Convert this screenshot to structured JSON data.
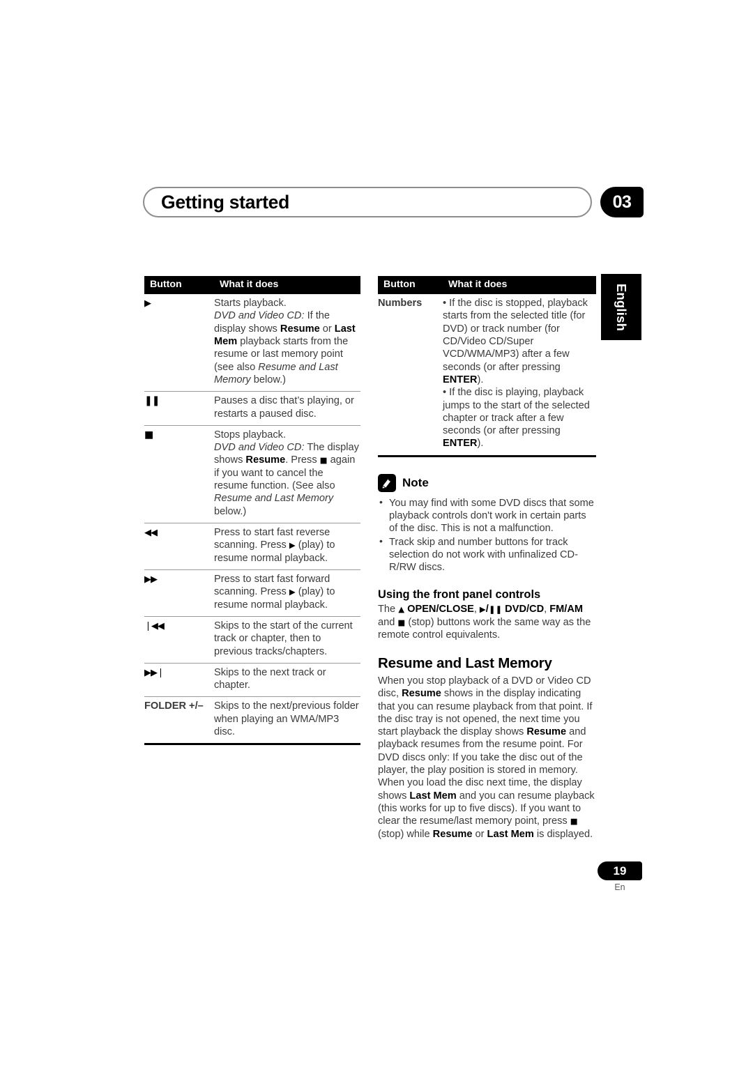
{
  "header": {
    "title": "Getting started",
    "chapter_number": "03"
  },
  "language_tab": "English",
  "left_table": {
    "columns": [
      "Button",
      "What it does"
    ],
    "rows": [
      {
        "button_icon": "play-icon",
        "button_glyph": "▶",
        "lines": [
          "Starts playback.",
          "DVD and Video CD: If the display shows Resume or Last Mem playback starts from the resume or last memory point (see also Resume and Last Memory below.)"
        ]
      },
      {
        "button_icon": "pause-icon",
        "button_glyph": "▐▐",
        "lines": [
          "Pauses a disc that's playing, or restarts a paused disc."
        ]
      },
      {
        "button_icon": "stop-icon",
        "button_glyph": "■",
        "lines": [
          "Stops playback.",
          "DVD and Video CD: The display shows Resume. Press ■ again if you want to cancel the resume function. (See also Resume and Last Memory below.)"
        ]
      },
      {
        "button_icon": "fast-reverse-icon",
        "button_glyph": "◀◀",
        "lines": [
          "Press to start fast reverse scanning. Press ▶ (play) to resume normal playback."
        ]
      },
      {
        "button_icon": "fast-forward-icon",
        "button_glyph": "▶▶",
        "lines": [
          "Press to start fast forward scanning. Press ▶ (play) to resume normal playback."
        ]
      },
      {
        "button_icon": "skip-previous-icon",
        "button_glyph": "⏮",
        "lines": [
          "Skips to the start of the current track or chapter, then to previous tracks/chapters."
        ]
      },
      {
        "button_icon": "skip-next-icon",
        "button_glyph": "⏭",
        "lines": [
          "Skips to the next track or chapter."
        ]
      },
      {
        "button_icon": "folder-label",
        "button_glyph": "FOLDER +/–",
        "lines": [
          "Skips to the next/previous folder when playing an WMA/MP3 disc."
        ]
      }
    ]
  },
  "right_table": {
    "columns": [
      "Button",
      "What it does"
    ],
    "rows": [
      {
        "button_label": "Numbers",
        "bullets": [
          "If the disc is stopped, playback starts from the selected title (for DVD) or track number (for CD/Video CD/Super VCD/WMA/MP3) after a few seconds (or after pressing ENTER).",
          "If the disc is playing, playback jumps to the start of the selected chapter or track after a few seconds (or after pressing ENTER)."
        ]
      }
    ]
  },
  "note": {
    "icon": "note-pencil-icon",
    "title": "Note",
    "bullets": [
      "You may find with some DVD discs that some playback controls don't work in certain parts of the disc. This is not a malfunction.",
      "Track skip and number buttons for track selection do not work with unfinalized CD-R/RW discs."
    ]
  },
  "front_panel": {
    "heading": "Using the front panel controls",
    "body": "The ⏏ OPEN/CLOSE, ▶/▐▐ DVD/CD, FM/AM and ■ (stop) buttons work the same way as the remote control equivalents."
  },
  "resume_section": {
    "heading": "Resume and Last Memory",
    "body": "When you stop playback of a DVD or Video CD disc, Resume shows in the display indicating that you can resume playback from that point. If the disc tray is not opened, the next time you start playback the display shows Resume and playback resumes from the resume point. For DVD discs only: If you take the disc out of the player, the play position is stored in memory. When you load the disc next time, the display shows Last Mem and you can resume playback (this works for up to five discs). If you want to clear the resume/last memory point, press ■ (stop) while Resume or Last Mem is displayed."
  },
  "footer": {
    "page_number": "19",
    "language_code": "En"
  },
  "colors": {
    "ink": "#231f20",
    "body_text": "#3b3b3b",
    "rule": "#9b9b9b",
    "black": "#000000"
  }
}
